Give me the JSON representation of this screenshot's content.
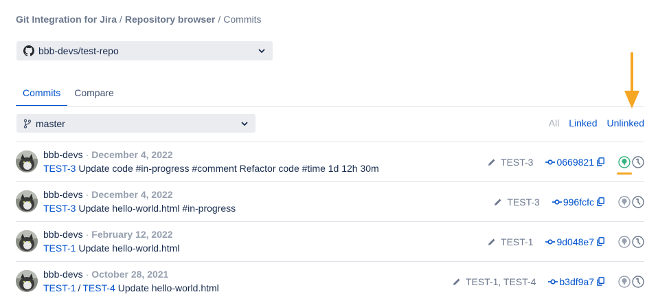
{
  "breadcrumb": {
    "app": "Git Integration for Jira",
    "section": "Repository browser",
    "current": "Commits",
    "separator": "/"
  },
  "repository": {
    "selected": "bbb-devs/test-repo",
    "icon": "github-icon"
  },
  "tabs": [
    {
      "label": "Commits",
      "active": true
    },
    {
      "label": "Compare",
      "active": false
    }
  ],
  "branch": {
    "selected": "master",
    "icon": "git-branch-icon"
  },
  "filters": {
    "all": "All",
    "linked": "Linked",
    "unlinked": "Unlinked"
  },
  "colors": {
    "link": "#0052cc",
    "highlight_arrow": "#f5a623",
    "linked_status": "#36b37e"
  },
  "commits": [
    {
      "author": "bbb-devs",
      "date": "December 4, 2022",
      "issues": [
        "TEST-3"
      ],
      "message": "Update code #in-progress #comment Refactor code #time 1d 12h 30m",
      "linked_issues": "TEST-3",
      "hash": "0669821",
      "highlighted": true
    },
    {
      "author": "bbb-devs",
      "date": "December 4, 2022",
      "issues": [
        "TEST-3"
      ],
      "message": "Update hello-world.html #in-progress",
      "linked_issues": "TEST-3",
      "hash": "996fcfc",
      "highlighted": false
    },
    {
      "author": "bbb-devs",
      "date": "February 12, 2022",
      "issues": [
        "TEST-1"
      ],
      "message": "Update hello-world.html",
      "linked_issues": "TEST-1",
      "hash": "9d048e7",
      "highlighted": false
    },
    {
      "author": "bbb-devs",
      "date": "October 28, 2021",
      "issues": [
        "TEST-1",
        "TEST-4"
      ],
      "message": "Update hello-world.html",
      "linked_issues": "TEST-1, TEST-4",
      "hash": "b3df9a7",
      "highlighted": false
    }
  ]
}
